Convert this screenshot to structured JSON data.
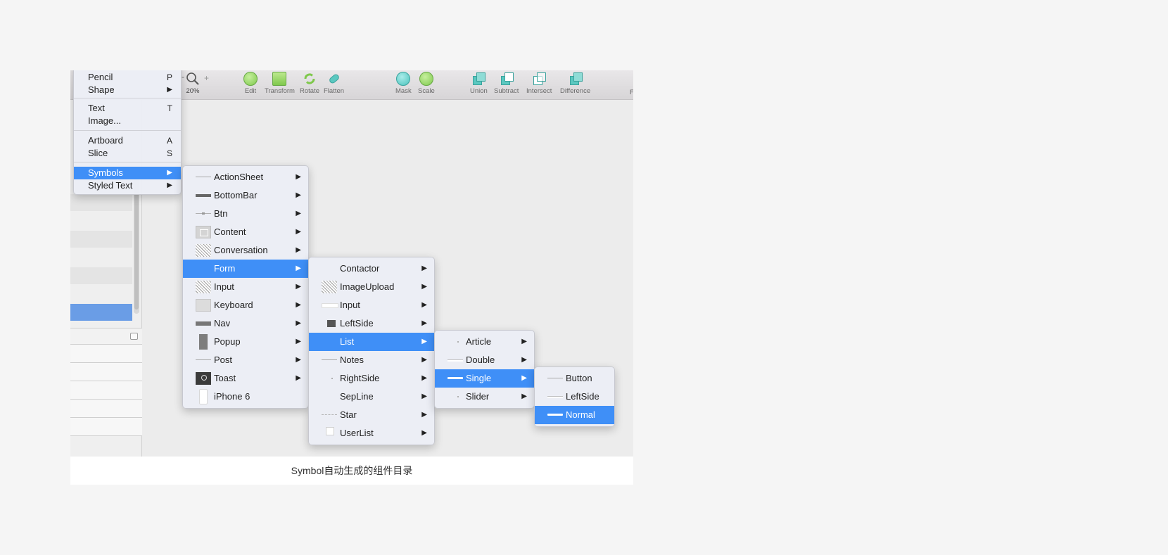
{
  "toolbar": {
    "zoom_value": "20%",
    "zoom_plus": "+",
    "zoom_minus": "-",
    "tools": [
      {
        "label": "Edit",
        "icon": "edit-icon"
      },
      {
        "label": "Transform",
        "icon": "transform-icon"
      },
      {
        "label": "Rotate",
        "icon": "rotate-icon"
      },
      {
        "label": "Flatten",
        "icon": "flatten-icon"
      },
      {
        "label": "Mask",
        "icon": "mask-icon"
      },
      {
        "label": "Scale",
        "icon": "scale-icon"
      },
      {
        "label": "Union",
        "icon": "union-icon"
      },
      {
        "label": "Subtract",
        "icon": "subtract-icon"
      },
      {
        "label": "Intersect",
        "icon": "intersect-icon"
      },
      {
        "label": "Difference",
        "icon": "difference-icon"
      }
    ],
    "overflow_letter": "F"
  },
  "insert_menu": {
    "items": [
      {
        "label": "Pencil",
        "key": "P"
      },
      {
        "label": "Shape",
        "key": "▶"
      },
      {
        "label": "Text",
        "key": "T"
      },
      {
        "label": "Image...",
        "key": ""
      },
      {
        "label": "Artboard",
        "key": "A"
      },
      {
        "label": "Slice",
        "key": "S"
      },
      {
        "label": "Symbols",
        "key": "▶"
      },
      {
        "label": "Styled Text",
        "key": "▶"
      }
    ]
  },
  "symbols_menu": {
    "items": [
      "ActionSheet",
      "BottomBar",
      "Btn",
      "Content",
      "Conversation",
      "Form",
      "Input",
      "Keyboard",
      "Nav",
      "Popup",
      "Post",
      "Toast",
      "iPhone 6"
    ]
  },
  "form_menu": {
    "items": [
      "Contactor",
      "ImageUpload",
      "Input",
      "LeftSide",
      "List",
      "Notes",
      "RightSide",
      "SepLine",
      "Star",
      "UserList"
    ]
  },
  "list_menu": {
    "items": [
      "Article",
      "Double",
      "Single",
      "Slider"
    ]
  },
  "single_menu": {
    "items": [
      "Button",
      "LeftSide",
      "Normal"
    ]
  },
  "arrow": "▶",
  "caption": "Symbol自动生成的组件目录",
  "colors": {
    "selection": "#3f8ff7",
    "menu_bg": "#eceef5",
    "page_bg": "#f5f5f5"
  }
}
